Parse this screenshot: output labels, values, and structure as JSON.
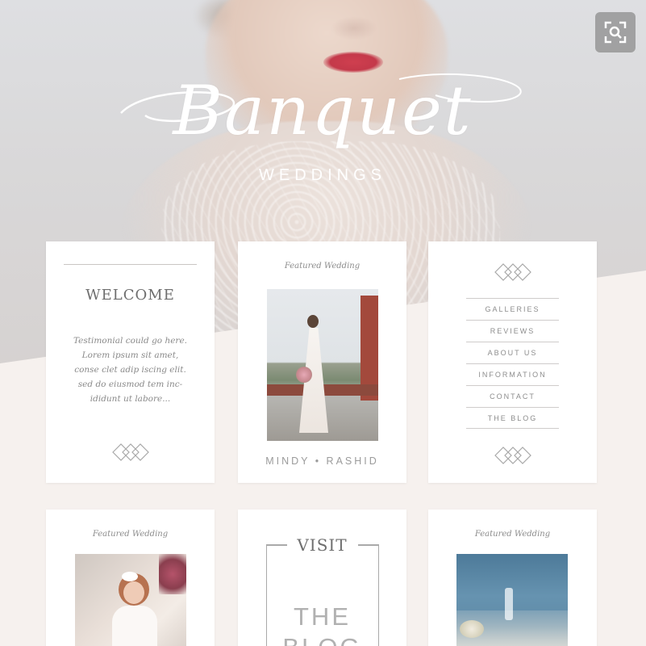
{
  "brand": {
    "logo_word": "Banquet",
    "logo_sub": "WEDDINGS"
  },
  "welcome_card": {
    "title": "WELCOME",
    "testimonial": "Testimonial could go here. Lorem ipsum sit amet, conse clet adip iscing elit. sed do eiusmod tem inc-ididunt ut labore..."
  },
  "featured_card_1": {
    "label": "Featured Wedding",
    "couple": "MINDY • RASHID"
  },
  "nav_card": {
    "items": [
      "GALLERIES",
      "REVIEWS",
      "ABOUT US",
      "INFORMATION",
      "CONTACT",
      "THE BLOG"
    ]
  },
  "featured_card_2": {
    "label": "Featured Wedding"
  },
  "blog_card": {
    "visit": "VISIT",
    "the_blog": "THE\nBLOG"
  },
  "featured_card_3": {
    "label": "Featured Wedding"
  },
  "icons": {
    "zoom": "zoom-search-icon",
    "ornament": "diamond-ornament-icon"
  },
  "colors": {
    "card": "#ffffff",
    "page": "#f6f1ee",
    "text_muted": "#8a8a8a",
    "lips": "#cf3f4f"
  }
}
